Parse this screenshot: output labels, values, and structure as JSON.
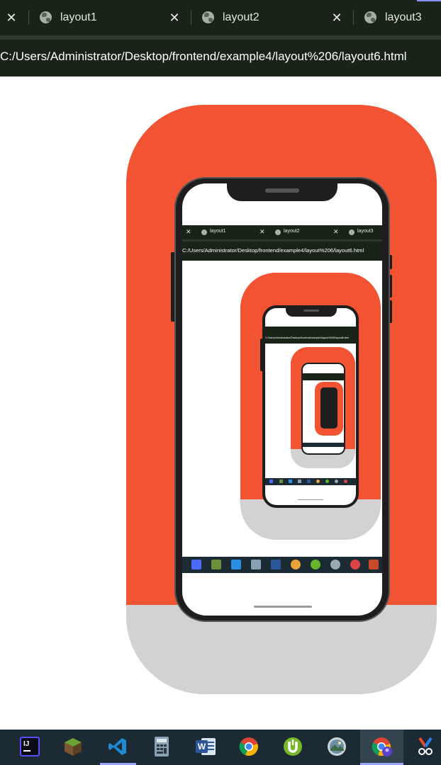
{
  "browser": {
    "tabs": [
      {
        "title": "layout1",
        "close": "✕"
      },
      {
        "title": "layout2",
        "close": "✕"
      },
      {
        "title": "layout3",
        "close": "✕"
      }
    ],
    "address": "C:/Users/Administrator/Desktop/frontend/example4/layout%206/layout6.html"
  },
  "colors": {
    "frame_top": "#f25433",
    "frame_bottom": "#d2d2d2",
    "chrome": "#192318",
    "taskbar": "#1c2a33"
  },
  "taskbar": {
    "icons": [
      {
        "name": "intellij-icon",
        "label": "IJ"
      },
      {
        "name": "minecraft-icon",
        "label": ""
      },
      {
        "name": "vscode-icon",
        "label": ""
      },
      {
        "name": "calculator-icon",
        "label": ""
      },
      {
        "name": "word-icon",
        "label": "W"
      },
      {
        "name": "chrome-icon",
        "label": ""
      },
      {
        "name": "utorrent-icon",
        "label": ""
      },
      {
        "name": "photos-icon",
        "label": ""
      },
      {
        "name": "chrome-profile-icon",
        "label": ""
      },
      {
        "name": "snipping-tool-icon",
        "label": ""
      }
    ]
  }
}
